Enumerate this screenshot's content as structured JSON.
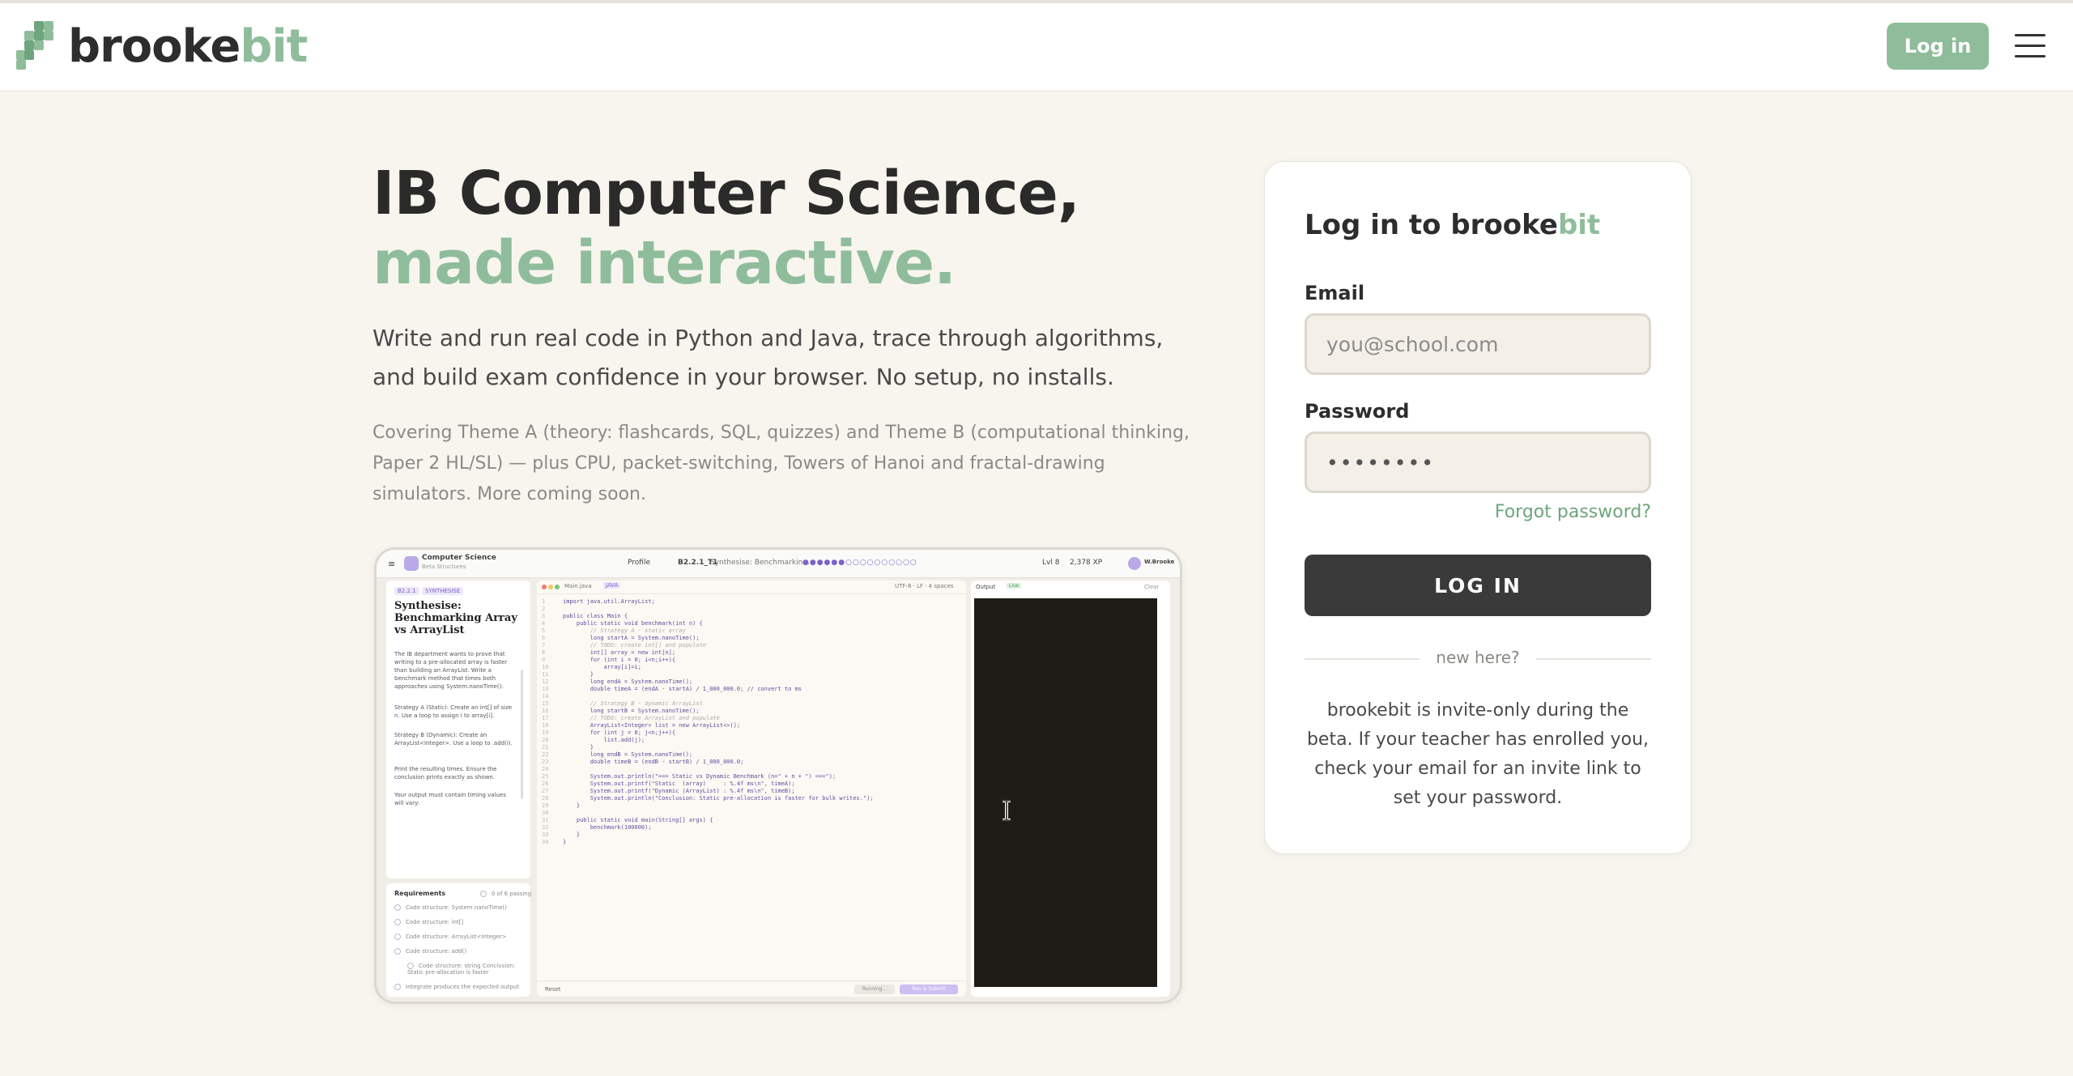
{
  "brand": {
    "name_a": "brooke",
    "name_b": "bit"
  },
  "header": {
    "login_label": "Log in"
  },
  "hero": {
    "title_line1": "IB Computer Science,",
    "title_line2": "made interactive.",
    "description": "Write and run real code in Python and Java, trace through algorithms, and build exam confidence in your browser. No setup, no installs.",
    "subtext": "Covering Theme A (theory: flashcards, SQL, quizzes) and Theme B (computational thinking, Paper 2 HL/SL) — plus CPU, packet-switching, Towers of Hanoi and fractal-drawing simulators. More coming soon."
  },
  "preview": {
    "course": "Computer Science",
    "course_sub": "Beta Structures",
    "tab_profile": "Profile",
    "lesson_code": "B2.2.1_T1",
    "lesson_name": "Synthesise: Benchmarkin...",
    "level": "Lvl 8",
    "xp": "2,378 XP",
    "user": "W.Brooke",
    "tag1": "B2.2.1",
    "tag2": "SYNTHESISE",
    "task_title": "Synthesise: Benchmarking Array vs ArrayList",
    "task_p1": "The IB department wants to prove that writing to a pre-allocated array is faster than building an ArrayList. Write a benchmark method that times both approaches using System.nanoTime().",
    "task_p2": "Strategy A (Static): Create an int[] of size n. Use a loop to assign i to array[i].",
    "task_p3": "Strategy B (Dynamic): Create an ArrayList<Integer>. Use a loop to .add(i).",
    "task_p4": "Print the resulting times. Ensure the conclusion prints exactly as shown.",
    "task_p5": "Your output must contain timing values will vary:",
    "requirements_title": "Requirements",
    "requirements_count": "0 of 6 passing",
    "requirements": [
      "Code structure: System.nanoTime()",
      "Code structure: int[]",
      "Code structure: ArrayList<Integer>",
      "Code structure: add()",
      "Code structure: string Conclusion: Static pre-allocation is faster",
      "Integrate produces the expected output"
    ],
    "editor_file": "Main.java",
    "editor_lang": "JAVA",
    "editor_pos": "UTF-8 · LF · 4 spaces",
    "code_lines": [
      "import java.util.ArrayList;",
      "",
      "public class Main {",
      "    public static void benchmark(int n) {",
      "        // Strategy A - static array",
      "        long startA = System.nanoTime();",
      "        // TODO: create int[] and populate",
      "        int[] array = new int[n];",
      "        for (int i = 0; i<n;i++){",
      "            array[i]=i;",
      "        }",
      "        long endA = System.nanoTime();",
      "        double timeA = (endA - startA) / 1_000_000.0; // convert to ms",
      "",
      "        // Strategy B - dynamic ArrayList",
      "        long startB = System.nanoTime();",
      "        // TODO: create ArrayList and populate",
      "        ArrayList<Integer> list = new ArrayList<>();",
      "        for (int j = 0; j<n;j++){",
      "            list.add(j);",
      "        }",
      "        long endB = System.nanoTime();",
      "        double timeB = (endB - startB) / 1_000_000.0;",
      "",
      "        System.out.println(\"=== Static vs Dynamic Benchmark (n=\" + n + \") ===\");",
      "        System.out.printf(\"Static  (array)     : %.4f ms\\n\", timeA);",
      "        System.out.printf(\"Dynamic (ArrayList) : %.4f ms\\n\", timeB);",
      "        System.out.println(\"Conclusion: Static pre-allocation is faster for bulk writes.\");",
      "    }",
      "",
      "    public static void main(String[] args) {",
      "        benchmark(100000);",
      "    }",
      "}"
    ],
    "reset_label": "Reset",
    "running_label": "Running...",
    "run_label": "Run & Submit",
    "output_label": "Output",
    "output_status": "Live",
    "clear_label": "Clear"
  },
  "login": {
    "title_a": "Log in to brooke",
    "title_b": "bit",
    "email_label": "Email",
    "email_placeholder": "you@school.com",
    "password_label": "Password",
    "password_value": "••••••••",
    "forgot": "Forgot password?",
    "submit": "LOG IN",
    "divider": "new here?",
    "invite": "brookebit is invite-only during the beta. If your teacher has enrolled you, check your email for an invite link to set your password."
  }
}
